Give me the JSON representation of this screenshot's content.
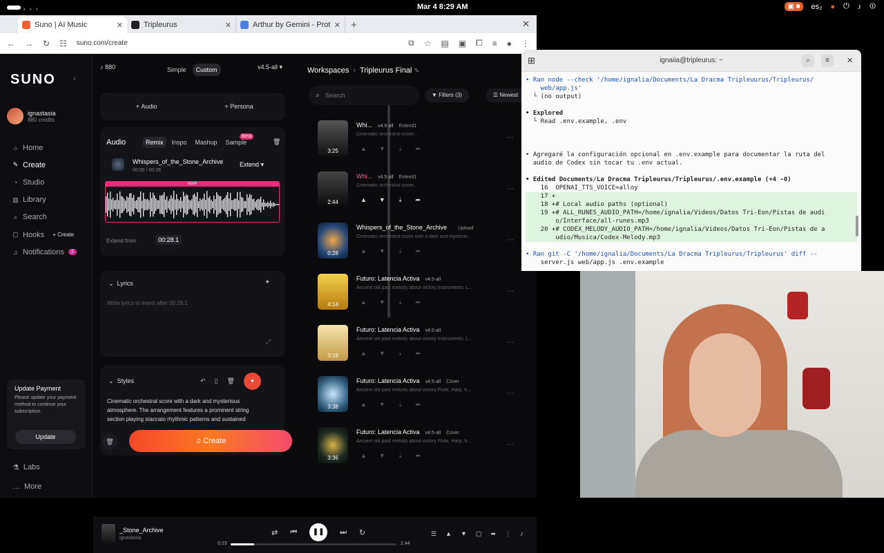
{
  "os": {
    "clock": "Mar 4   8:29 AM",
    "lang": "es₂"
  },
  "browser": {
    "tabs": [
      {
        "title": "Suno | AI Music",
        "color": "#f2612f"
      },
      {
        "title": "Tripleurus",
        "color": "#222222"
      },
      {
        "title": "Arthur by Gemini - Proto",
        "color": "#4a7fe0"
      }
    ],
    "url": "suno.com/create"
  },
  "sidebar": {
    "logo": "SUNO",
    "user": {
      "name": "ignastasia",
      "credits": "880 credits"
    },
    "nav": [
      {
        "label": "Home",
        "icon": "home-icon"
      },
      {
        "label": "Create",
        "icon": "create-icon"
      },
      {
        "label": "Studio",
        "icon": "studio-icon"
      },
      {
        "label": "Library",
        "icon": "library-icon"
      },
      {
        "label": "Search",
        "icon": "search-icon"
      },
      {
        "label": "Hooks",
        "icon": "hooks-icon"
      },
      {
        "label": "Notifications",
        "icon": "bell-icon"
      }
    ],
    "hooks_create": "+ Create",
    "notif_count": "2",
    "update": {
      "title": "Update Payment",
      "desc": "Please update your payment method to continue your subscription.",
      "button": "Update"
    },
    "bottom": [
      {
        "label": "Labs"
      },
      {
        "label": "More"
      }
    ]
  },
  "create": {
    "credits": "880",
    "mode_simple": "Simple",
    "mode_custom": "Custom",
    "version": "v4.5-all",
    "add_audio": "Audio",
    "add_persona": "Persona",
    "audio_header": "Audio",
    "audio_tabs": [
      "Remix",
      "Inspo",
      "Mashup",
      "Sample"
    ],
    "beta": "Beta",
    "track_name": "Whispers_of_the_Stone_Archive",
    "track_time": "00:00 / 00:28",
    "extend": "Extend",
    "keep": "KEEP",
    "extend_from_label": "Extend from",
    "extend_from_value": "00:28.1",
    "lyrics_header": "Lyrics",
    "lyrics_placeholder": "Write lyrics to insert after 00:28.1",
    "styles_header": "Styles",
    "styles_text": "Cinematic orchestral score with a dark and mysterious atmosphere. The arrangement features a prominent string section playing staccato rhythmic patterns and sustained",
    "create_button": "Create"
  },
  "workspace": {
    "crumb_root": "Workspaces",
    "crumb_current": "Tripleurus Final",
    "search_placeholder": "Search",
    "filters": "Filters (3)",
    "sort": "Newest",
    "songs": [
      {
        "title": "Whi...",
        "ver": "v4.5-all",
        "tag": "Extend1",
        "desc": "Cinematic orchestral score...",
        "dur": "3:25",
        "art": "linear-gradient(#555,#111)"
      },
      {
        "title": "Whi...",
        "ver": "v4.5-all",
        "tag": "Extend1",
        "desc": "Cinematic orchestral score...",
        "dur": "2:44",
        "art": "linear-gradient(#444,#0a0a0a)"
      },
      {
        "title": "Whispers_of_the_Stone_Archive",
        "ver": "",
        "tag": "Upload",
        "desc": "Cinematic orchestral score with a dark and mysterio...",
        "dur": "0:28",
        "art": "radial-gradient(circle,#f2a64a,#2a4a7a 60%,#0c1a2f)"
      },
      {
        "title": "Futuro: Latencia Activa",
        "ver": "v4.5-all",
        "tag": "",
        "desc": "Ancient old past melody about victory Instruments: L...",
        "dur": "4:14",
        "art": "linear-gradient(#f2d24a,#b87a10)"
      },
      {
        "title": "Futuro: Latencia Activa",
        "ver": "v4.5-all",
        "tag": "",
        "desc": "Ancient old past melody about victory Instruments: L...",
        "dur": "3:19",
        "art": "linear-gradient(#f5e6b0,#c49a45)"
      },
      {
        "title": "Futuro: Latencia Activa",
        "ver": "v4.5-all",
        "tag": "Cover",
        "desc": "Ancient old past melody about victory Flute, Harp, h...",
        "dur": "3:38",
        "art": "radial-gradient(circle,#c8e6ff,#3a6a8a 60%,#0e2030)"
      },
      {
        "title": "Futuro: Latencia Activa",
        "ver": "v4.5-all",
        "tag": "Cover",
        "desc": "Ancient old past melody about victory Flute, Harp, h...",
        "dur": "3:36",
        "art": "radial-gradient(circle,#d8b44a,#1d2a22 60%,#0a0f0c)"
      }
    ]
  },
  "player": {
    "title": "_Stone_Archive",
    "user": "ignastasia",
    "elapsed": "0:23",
    "total": "2:44",
    "progress": 0.14
  },
  "terminal": {
    "title": "ignaiia@tripleurus: ~",
    "lines": [
      {
        "t": "• Ran node --check '/home/ignalia/Documents/La Dracma Tripleuurus/Tripleurus/",
        "c": "b"
      },
      {
        "t": "    web/app.js'",
        "c": "b"
      },
      {
        "t": "  └ (no output)",
        "c": ""
      },
      {
        "t": "",
        "c": ""
      },
      {
        "t": "• Explored",
        "c": "kw"
      },
      {
        "t": "  └ Read .env.example, .env",
        "c": ""
      },
      {
        "t": "",
        "c": ""
      },
      {
        "t": "",
        "c": ""
      },
      {
        "t": "",
        "c": ""
      },
      {
        "t": "• Agregaré la configuración opcional en .env.example para documentar la ruta del",
        "c": ""
      },
      {
        "t": "  audio de Codex sin tocar tu .env actual.",
        "c": ""
      },
      {
        "t": "",
        "c": ""
      },
      {
        "t": "• Edited Documents/La Dracma Tripleurus/Tripleurus/.env.example (+4 -0)",
        "c": "kw"
      },
      {
        "t": "    16  OPENAI_TTS_VOICE=alloy",
        "c": ""
      },
      {
        "t": "    17 +",
        "c": "diff"
      },
      {
        "t": "    18 +# Local audio paths (optional)",
        "c": "diff"
      },
      {
        "t": "    19 +# ALL_RUNES_AUDIO_PATH=/home/ignalia/Videos/Datos Tri-Eon/Pistas de audi",
        "c": "diff"
      },
      {
        "t": "        o/Interface/all-runes.mp3",
        "c": "diff"
      },
      {
        "t": "    20 +# CODEX_MELODY_AUDIO_PATH=/home/ignalia/Videos/Datos Tri-Eon/Pistas de a",
        "c": "diff"
      },
      {
        "t": "        udio/Musica/Codex-Melody.mp3",
        "c": "diff"
      },
      {
        "t": "",
        "c": ""
      },
      {
        "t": "• Ran git -C '/home/ignalia/Documents/La Dracma Tripleurus/Tripleurus' diff --",
        "c": "b"
      },
      {
        "t": "    server.js web/app.js .env.example",
        "c": ""
      }
    ]
  }
}
